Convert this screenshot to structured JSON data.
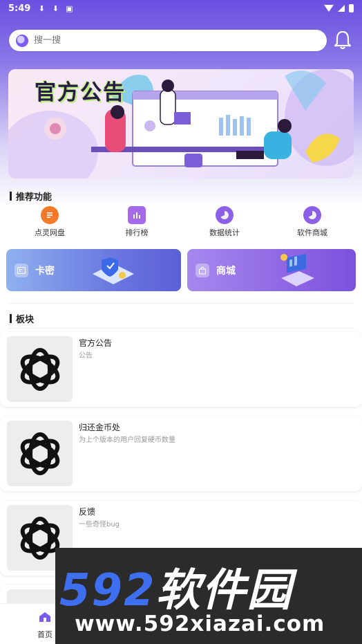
{
  "status_bar": {
    "time": "5:49"
  },
  "search": {
    "placeholder": "搜一搜"
  },
  "banner": {
    "title": "官方公告"
  },
  "recommend": {
    "section_title": "推荐功能",
    "items": [
      {
        "label": "点灵网盘",
        "icon": "list-icon",
        "color": "#f47a2a"
      },
      {
        "label": "排行榜",
        "icon": "chart-icon",
        "color": "#a56ae8"
      },
      {
        "label": "数据统计",
        "icon": "pie-icon",
        "color": "#8b5fe6"
      },
      {
        "label": "软件商城",
        "icon": "pie-icon",
        "color": "#8b5fe6"
      }
    ]
  },
  "cards": [
    {
      "label": "卡密",
      "icon": "card-icon",
      "color": "#6b7de6"
    },
    {
      "label": "商城",
      "icon": "bag-icon",
      "color": "#9a72e8"
    }
  ],
  "board": {
    "section_title": "板块",
    "items": [
      {
        "title": "官方公告",
        "desc": "公告"
      },
      {
        "title": "归还金币处",
        "desc": "为上个版本的用户回复硬币数量"
      },
      {
        "title": "反馈",
        "desc": "一些奇怪bug"
      }
    ]
  },
  "nav": {
    "home_label": "首页"
  },
  "watermark": {
    "brand_num": "592",
    "brand_cn": "软件园",
    "url": "www.592xiazai.com"
  }
}
